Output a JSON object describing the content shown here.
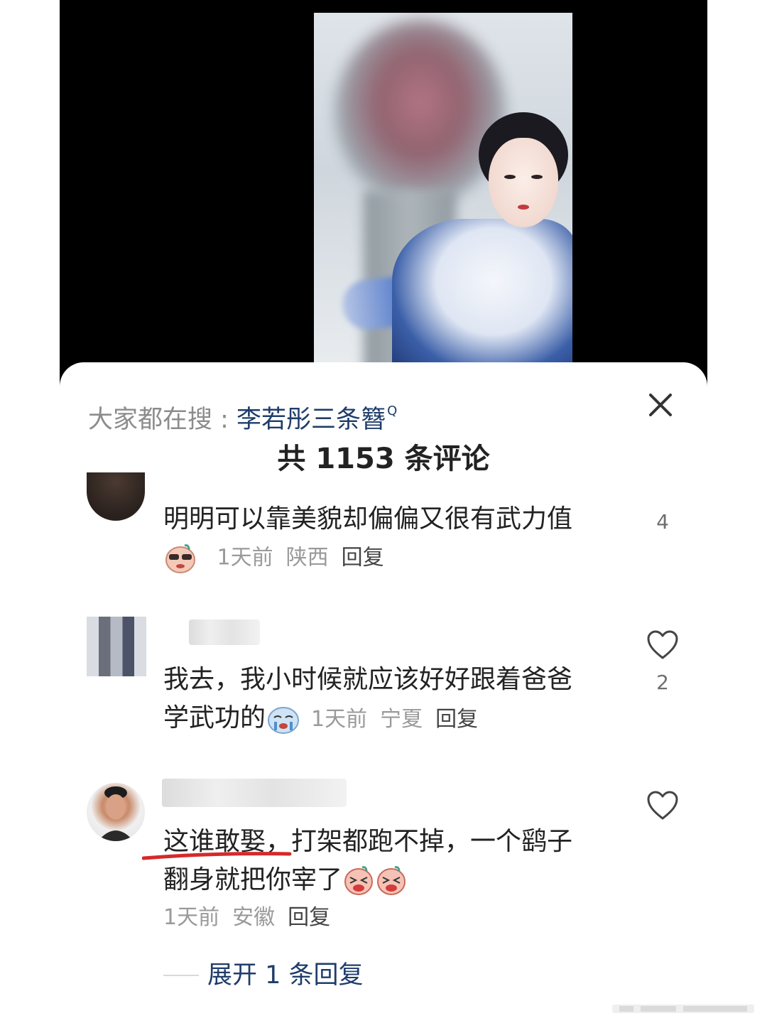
{
  "search": {
    "prefix": "大家都在搜 : ",
    "keyword": "李若彤三条簪",
    "superscript": "Q"
  },
  "comments_header": {
    "count_label": "共 1153 条评论"
  },
  "comments": [
    {
      "text": "明明可以靠美貌却偏偏又很有武力值",
      "time": "1天前",
      "location": "陕西",
      "reply_label": "回复",
      "like_count": "4"
    },
    {
      "text_line1": "我去，我小时候就应该好好跟着爸爸",
      "text_line2": "学武功的",
      "time": "1天前",
      "location": "宁夏",
      "reply_label": "回复",
      "like_count": "2"
    },
    {
      "text_line1": "这谁敢娶，打架都跑不掉，一个鹞子",
      "text_line2": "翻身就把你宰了",
      "time": "1天前",
      "location": "安徽",
      "reply_label": "回复"
    }
  ],
  "expand_replies": "展开 1 条回复",
  "colors": {
    "link_blue": "#1f3d6b",
    "meta_gray": "#9a9a9a",
    "underline_red": "#d42a2a"
  },
  "icons": [
    "close-icon",
    "heart-outline-icon",
    "emoji-sticker-icon"
  ]
}
